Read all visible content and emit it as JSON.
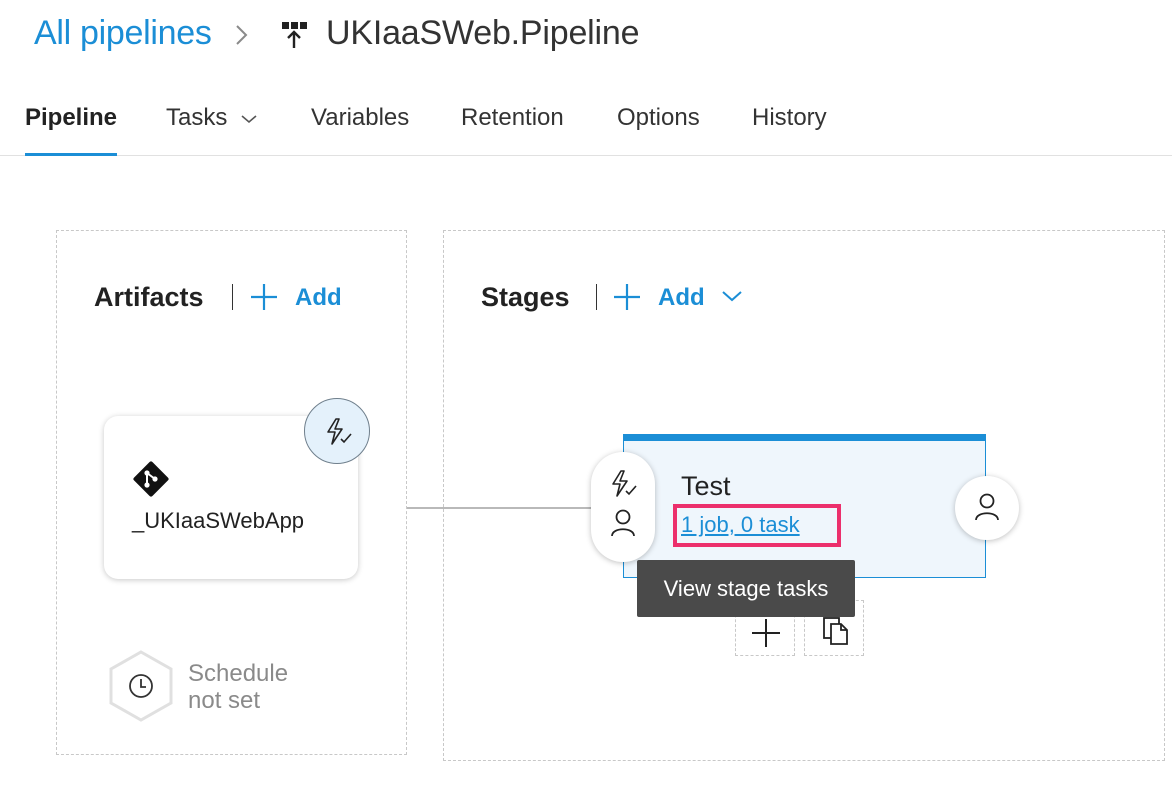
{
  "breadcrumb": {
    "parent": "All pipelines",
    "title": "UKIaaSWeb.Pipeline"
  },
  "tabs": [
    {
      "label": "Pipeline",
      "active": true
    },
    {
      "label": "Tasks"
    },
    {
      "label": "Variables"
    },
    {
      "label": "Retention"
    },
    {
      "label": "Options"
    },
    {
      "label": "History"
    }
  ],
  "artifacts": {
    "title": "Artifacts",
    "add_label": "Add",
    "items": [
      {
        "name": "_UKIaaSWebApp",
        "icon": "git-icon"
      }
    ],
    "schedule": {
      "line1": "Schedule",
      "line2": "not set"
    }
  },
  "stages": {
    "title": "Stages",
    "add_label": "Add",
    "items": [
      {
        "name": "Test",
        "summary": "1 job, 0 task"
      }
    ],
    "tooltip": "View stage tasks"
  },
  "colors": {
    "accent": "#1b8ed6",
    "highlight": "#ec2f6c",
    "tooltip_bg": "#4a4a4a",
    "stage_bg": "#eff6fc"
  }
}
